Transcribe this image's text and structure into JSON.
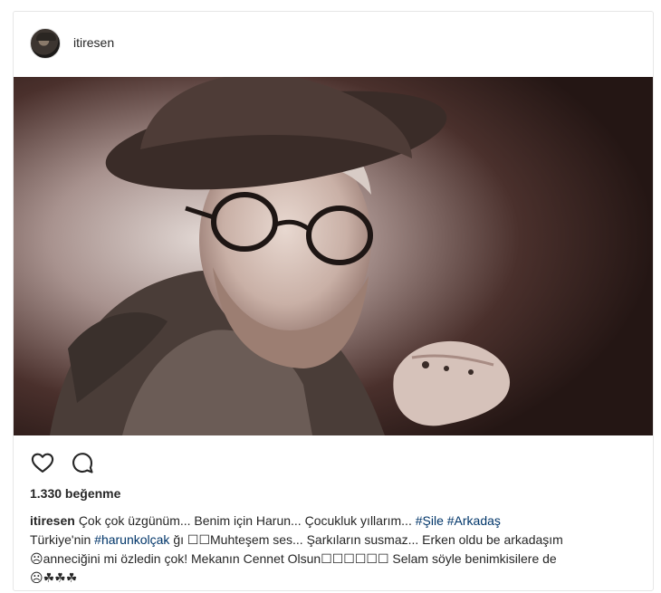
{
  "post": {
    "username": "itiresen",
    "likes_text": "1.330 beğenme",
    "caption": {
      "user": "itiresen",
      "line1_text": "Çok çok üzgünüm... Benim için Harun... Çocukluk yıllarım... ",
      "tag1": "#Şile",
      "tag2": "#Arkadaş",
      "line2_pre": "Türkiye'nin ",
      "tag3": "#harunkolçak",
      "line2_post": " ğı ☐☐Muhteşem ses... Şarkıların susmaz... Erken oldu be arkadaşım",
      "line3": "☹anneciğini mi özledin çok! Mekanın Cennet Olsun☐☐☐☐☐☐ Selam söyle benimkisilere de",
      "line4": "☹☘☘☘"
    }
  },
  "icons": {
    "like": "heart-icon",
    "comment": "comment-icon"
  },
  "colors": {
    "text": "#262626",
    "hashtag": "#003569",
    "border": "#e6e6e6"
  }
}
